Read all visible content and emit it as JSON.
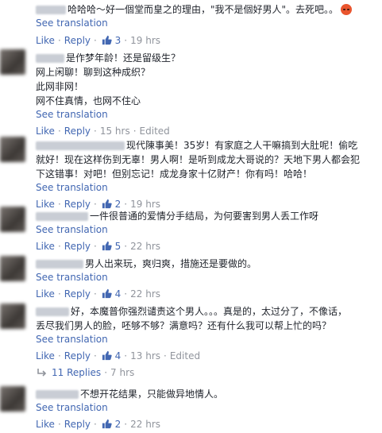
{
  "see_translation": "See translation",
  "like_label": "Like",
  "reply_label": "Reply",
  "comments": [
    {
      "lines": [
        "哈哈哈～好一個堂而皇之的理由，\"我不是個好男人\"。去死吧。。"
      ],
      "likes": "3",
      "time": "19 hrs",
      "edited": "",
      "emoji": "angry-face"
    },
    {
      "lines": [
        "是作梦年龄！还是留级生？",
        "网上闲聊！聊到这种成织？",
        "此网非网！",
        "网不住真情，也网不住心"
      ],
      "likes": "",
      "time": "15 hrs",
      "edited": "Edited"
    },
    {
      "lines": [
        "现代陳事美！35岁！有家庭之人干嘛搞到大肚呢！偷吃",
        "就好！现在这样伤到无辜！男人啊！是听到成龙大哥说的？天地下男人都会犯",
        "下这错事！对吧！但别忘记！成龙身家十亿财产！你有吗！哈哈！"
      ],
      "likes": "2",
      "time": "19 hrs",
      "edited": ""
    },
    {
      "lines": [
        "一件很普通的爱情分手结局，为何要害到男人丢工作呀"
      ],
      "likes": "5",
      "time": "22 hrs",
      "edited": ""
    },
    {
      "lines": [
        "男人出来玩，爽归爽，措施还是要做的。"
      ],
      "likes": "4",
      "time": "22 hrs",
      "edited": ""
    },
    {
      "lines": [
        "好，本魔普你强烈谴责这个男人。。。真是的，太过分了，不像话，",
        "丢尽我们男人的脸，呸够不够？满意吗？还有什么我可以帮上忙的吗？"
      ],
      "likes": "4",
      "time": "13 hrs",
      "edited": "Edited"
    },
    {
      "lines": [
        "不想开花结果，只能做异地情人。"
      ],
      "likes": "2",
      "time": "22 hrs",
      "edited": ""
    }
  ],
  "replies_thread": {
    "label": "11 Replies",
    "time": "7 hrs"
  }
}
